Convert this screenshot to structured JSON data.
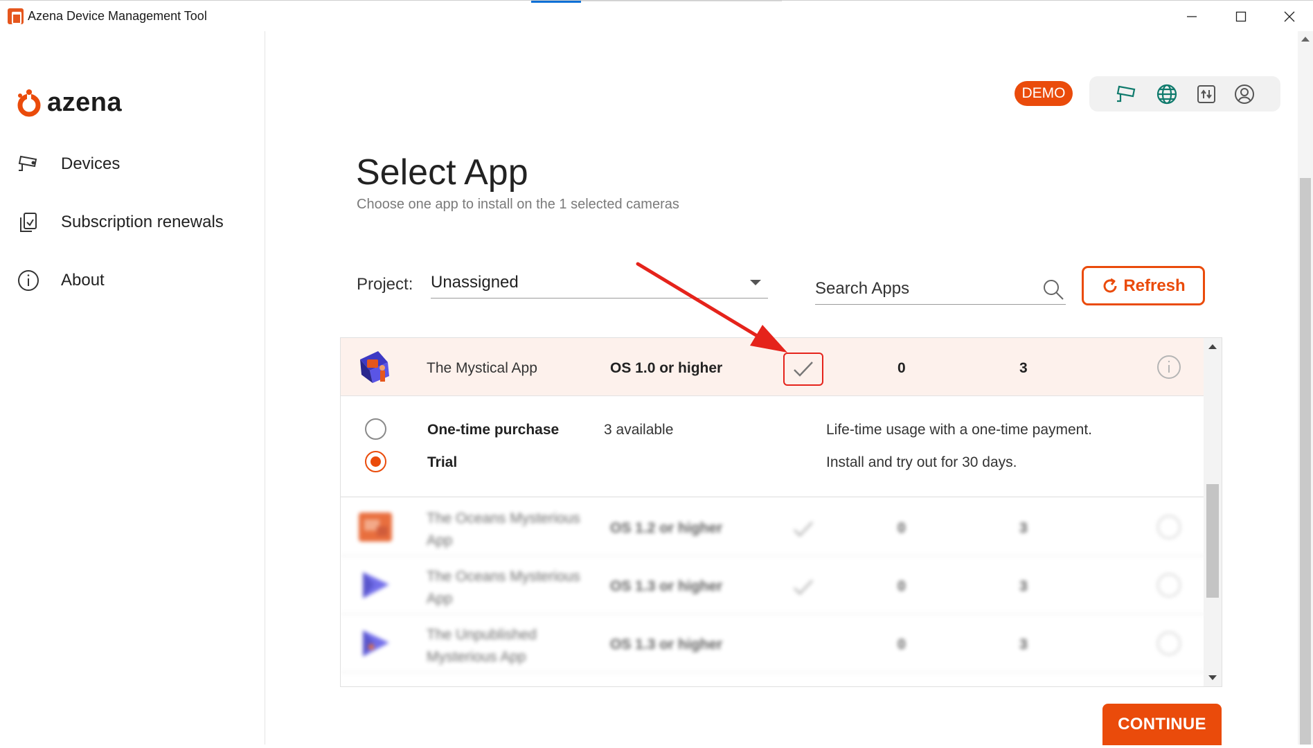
{
  "window": {
    "title": "Azena Device Management Tool"
  },
  "brand": {
    "name": "azena",
    "accent_color": "#ea4b0b"
  },
  "sidebar": {
    "items": [
      {
        "label": "Devices",
        "icon": "camera-icon"
      },
      {
        "label": "Subscription renewals",
        "icon": "renew-icon"
      },
      {
        "label": "About",
        "icon": "info-icon"
      }
    ]
  },
  "header": {
    "badge": "DEMO",
    "tools": [
      "camera-icon",
      "globe-icon",
      "upload-icon",
      "user-icon"
    ]
  },
  "page": {
    "title": "Select App",
    "subtitle": "Choose one app to install on the 1 selected cameras"
  },
  "filters": {
    "project_label": "Project:",
    "project_value": "Unassigned",
    "search_placeholder": "Search Apps",
    "refresh_label": "Refresh"
  },
  "apps": [
    {
      "name": "The Mystical App",
      "os": "OS 1.0 or higher",
      "compatible": true,
      "count_a": "0",
      "count_b": "3",
      "selected": true
    },
    {
      "name": "The Oceans Mysterious App",
      "os": "OS 1.2 or higher",
      "compatible": true,
      "count_a": "0",
      "count_b": "3",
      "selected": false
    },
    {
      "name": "The Oceans Mysterious App",
      "os": "OS 1.3 or higher",
      "compatible": true,
      "count_a": "0",
      "count_b": "3",
      "selected": false
    },
    {
      "name": "The Unpublished Mysterious App",
      "os": "OS 1.3 or higher",
      "compatible": false,
      "count_a": "0",
      "count_b": "3",
      "selected": false
    }
  ],
  "licenses": [
    {
      "name": "One-time purchase",
      "availability": "3 available",
      "description": "Life-time usage with a one-time payment.",
      "selected": false
    },
    {
      "name": "Trial",
      "availability": "",
      "description": "Install and try out for 30 days.",
      "selected": true
    }
  ],
  "footer": {
    "continue_label": "CONTINUE"
  }
}
